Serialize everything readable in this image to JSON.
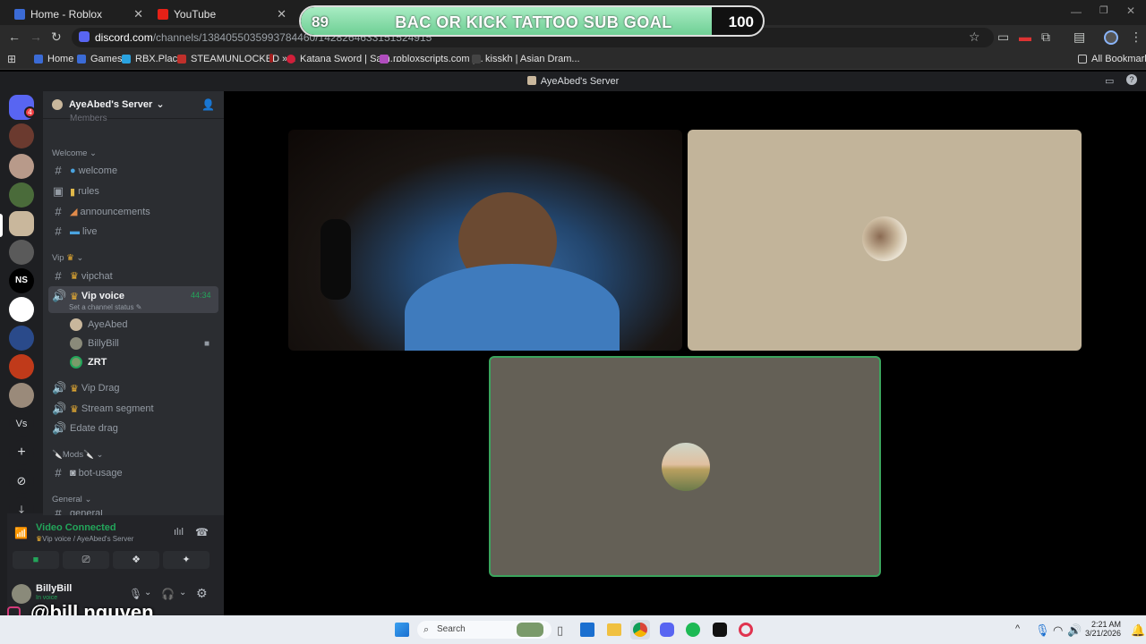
{
  "browser": {
    "tabs": [
      {
        "label": "Home - Roblox",
        "color": "#3b6bd6"
      },
      {
        "label": "YouTube",
        "color": "#e62117"
      }
    ],
    "url_host": "discord.com",
    "url_path": "/channels/1384055035993784460/1428264633151524915",
    "bookmarks": [
      "Home",
      "Games",
      "RBX.Place",
      "STEAMUNLOCKED »...",
      "Katana Sword | Sam...",
      "robloxscripts.com |...",
      "kisskh | Asian Dram...",
      "All Bookmarks"
    ]
  },
  "goal": {
    "current": "89",
    "title": "BAC OR KICK TATTOO SUB GOAL",
    "target": "100",
    "progress": 0.89
  },
  "discord": {
    "window_title": "AyeAbed's Server",
    "server_name": "AyeAbed's Server",
    "truncated_top": "Members",
    "categories": {
      "welcome": "Welcome",
      "vip": "Vip",
      "mods": "Mods",
      "general": "General"
    },
    "channels": {
      "welcome": "welcome",
      "rules": "rules",
      "announcements": "announcements",
      "live": "live",
      "vipchat": "vipchat",
      "vip_voice": "Vip voice",
      "vip_voice_timer": "44:34",
      "channel_status": "Set a channel status",
      "vip_drag": "Vip Drag",
      "stream_segment": "Stream segment",
      "edate_drag": "Edate drag",
      "bot_usage": "bot-usage",
      "general_cut": "general"
    },
    "voice_members": [
      "AyeAbed",
      "BillyBill",
      "ZRT"
    ],
    "voice_panel": {
      "status": "Video Connected",
      "location": "Vip voice / AyeAbed's Server"
    },
    "user": {
      "name": "BillyBill",
      "status": "In voice"
    },
    "server_badge": "4",
    "server_text_icons": [
      "NS",
      "Vs"
    ]
  },
  "watermark": "@bill.nguyen",
  "taskbar": {
    "search": "Search",
    "time": "2:21 AM",
    "date": "3/21/2026"
  }
}
